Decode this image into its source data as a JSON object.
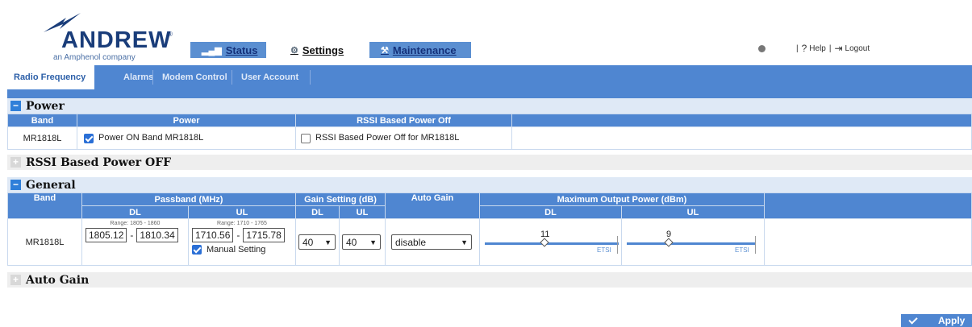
{
  "brand": {
    "name": "ANDREW",
    "reg": "®",
    "tagline": "an Amphenol company"
  },
  "main_tabs": [
    {
      "label": "Status",
      "icon": "bar-chart-icon"
    },
    {
      "label": "Settings",
      "icon": "gears-icon",
      "active": true
    },
    {
      "label": "Maintenance",
      "icon": "tools-icon"
    }
  ],
  "top_right": {
    "help": "Help",
    "logout": "Logout",
    "sep": "|",
    "help_glyph": "?",
    "logout_glyph": "⇥"
  },
  "sub_tabs": [
    {
      "label": "Radio Frequency",
      "active": true
    },
    {
      "label": "Alarms"
    },
    {
      "label": "Modem Control"
    },
    {
      "label": "User Account"
    }
  ],
  "power_section": {
    "title": "Power",
    "toggle": "−",
    "headers": {
      "band": "Band",
      "power": "Power",
      "rssi": "RSSI Based Power Off"
    },
    "row": {
      "band": "MR1818L",
      "power_label": "Power ON Band MR1818L",
      "power_checked": true,
      "rssi_label": "RSSI Based Power Off for MR1818L",
      "rssi_checked": false
    }
  },
  "rssi_section": {
    "title": "RSSI Based Power OFF",
    "toggle": "+"
  },
  "general_section": {
    "title": "General",
    "toggle": "−",
    "headers": {
      "band": "Band",
      "passband": "Passband (MHz)",
      "gain": "Gain Setting (dB)",
      "auto_gain": "Auto Gain",
      "max_power": "Maximum Output Power (dBm)",
      "dl": "DL",
      "ul": "UL"
    },
    "row": {
      "band": "MR1818L",
      "dl_range": "Range: 1805 - 1860",
      "ul_range": "Range: 1710 - 1765",
      "dl_from": "1805.12",
      "dl_to": "1810.34",
      "ul_from": "1710.56",
      "ul_to": "1715.78",
      "range_sep": "-",
      "manual_label": "Manual Setting",
      "manual_checked": true,
      "gain_dl": "40",
      "gain_ul": "40",
      "auto_gain_value": "disable",
      "max_dl": "11",
      "max_ul": "9",
      "etsi": "ETSI"
    }
  },
  "auto_gain_section": {
    "title": "Auto Gain",
    "toggle": "+"
  },
  "apply_label": "Apply",
  "colors": {
    "nav_blue": "#4f86d1",
    "section_header": "#dfe9f6",
    "toggle_blue": "#2f7fd9"
  }
}
